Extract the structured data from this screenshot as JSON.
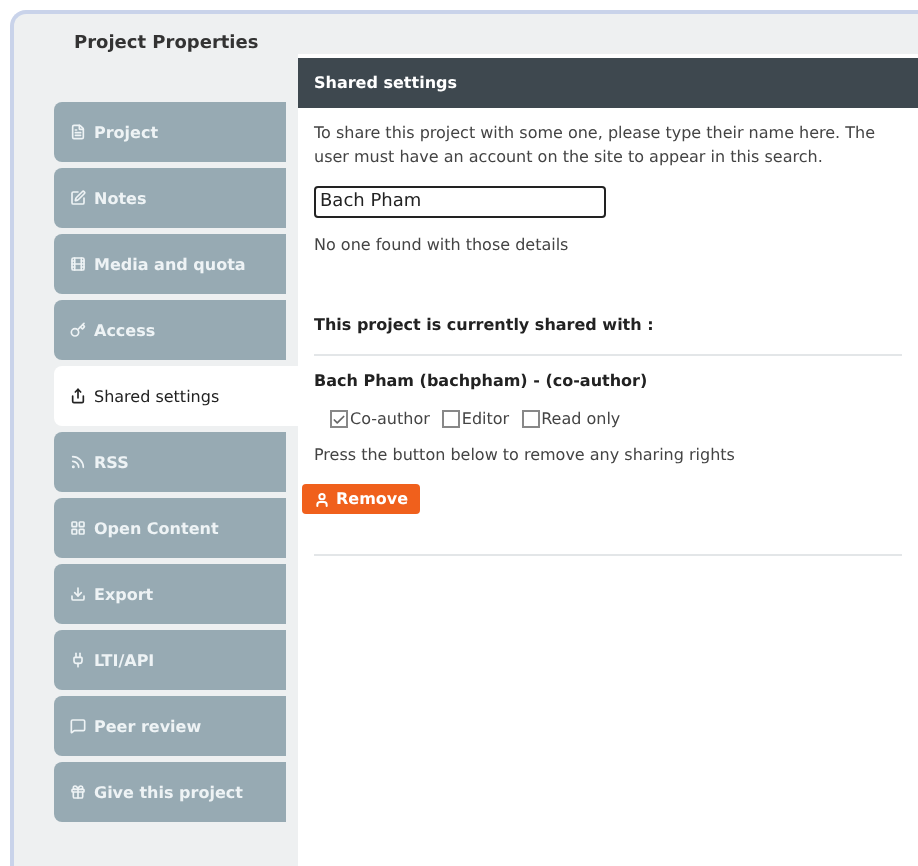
{
  "window": {
    "title": "Project Properties"
  },
  "sidebar": {
    "items": [
      {
        "label": "Project",
        "selected": false
      },
      {
        "label": "Notes",
        "selected": false
      },
      {
        "label": "Media and quota",
        "selected": false
      },
      {
        "label": "Access",
        "selected": false
      },
      {
        "label": "Shared settings",
        "selected": true
      },
      {
        "label": "RSS",
        "selected": false
      },
      {
        "label": "Open Content",
        "selected": false
      },
      {
        "label": "Export",
        "selected": false
      },
      {
        "label": "LTI/API",
        "selected": false
      },
      {
        "label": "Peer review",
        "selected": false
      },
      {
        "label": "Give this project",
        "selected": false
      }
    ]
  },
  "panel": {
    "title": "Shared settings",
    "intro": "To share this project with some one, please type their name here. The user must have an account on the site to appear in this search.",
    "search": {
      "value": "Bach Pham"
    },
    "search_result": "No one found with those details",
    "shared_heading": "This project is currently shared with :",
    "shares": [
      {
        "user": "Bach Pham (bachpham) - (co-author)",
        "roles": [
          {
            "label": "Co-author",
            "checked": true
          },
          {
            "label": "Editor",
            "checked": false
          },
          {
            "label": "Read only",
            "checked": false
          }
        ],
        "remove_hint": "Press the button below to remove any sharing rights",
        "remove_button": "Remove"
      }
    ]
  }
}
